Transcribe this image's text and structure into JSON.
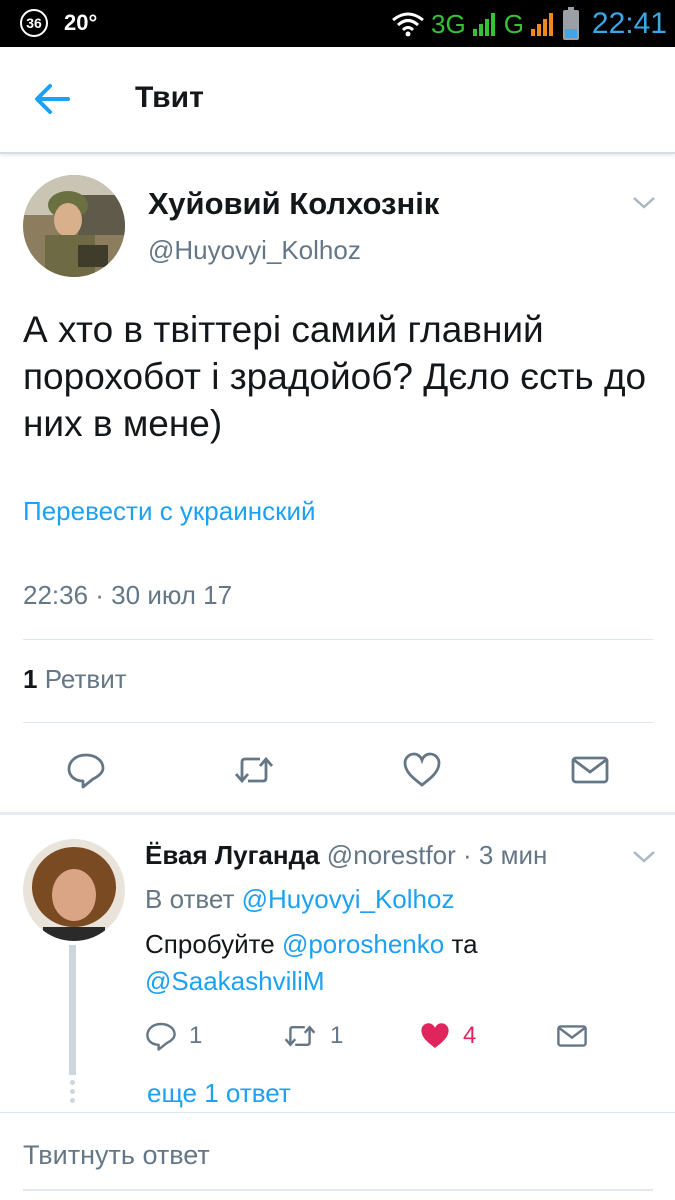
{
  "status_bar": {
    "badge": "36",
    "temperature": "20°",
    "network_3g": "3G",
    "network_g": "G",
    "clock": "22:41",
    "icons": [
      "wifi-icon",
      "signal-icon",
      "battery-icon"
    ]
  },
  "header": {
    "title": "Твит",
    "back_icon": "arrow-left-icon"
  },
  "tweet": {
    "author_name": "Хуйовий Колхознік",
    "author_handle": "@Huyovyi_Kolhoz",
    "text": "А хто в твіттері самий главний порохобот і зрадойоб? Дєло єсть до них в мене)",
    "translate_label": "Перевести с украинский",
    "timestamp": "22:36 · 30 июл 17",
    "retweet_count": "1",
    "retweet_label": "Ретвит",
    "actions": [
      "reply-icon",
      "retweet-icon",
      "like-icon",
      "message-icon"
    ]
  },
  "reply": {
    "author_name": "Ёвая Луганда",
    "author_handle": "@norestfor",
    "time": "· 3 мин",
    "in_reply_prefix": "В ответ",
    "in_reply_handle": "@Huyovyi_Kolhoz",
    "text_prefix": "Спробуйте",
    "mention1": "@poroshenko",
    "text_middle": "та",
    "mention2": "@SaakashviliM",
    "reply_count": "1",
    "retweet_count": "1",
    "like_count": "4",
    "more_replies": "еще 1 ответ"
  },
  "composer": {
    "placeholder": "Твитнуть ответ"
  },
  "colors": {
    "accent": "#1da1f2",
    "secondary_text": "#657786",
    "like": "#e0245e",
    "divider": "#e1e8ed"
  }
}
